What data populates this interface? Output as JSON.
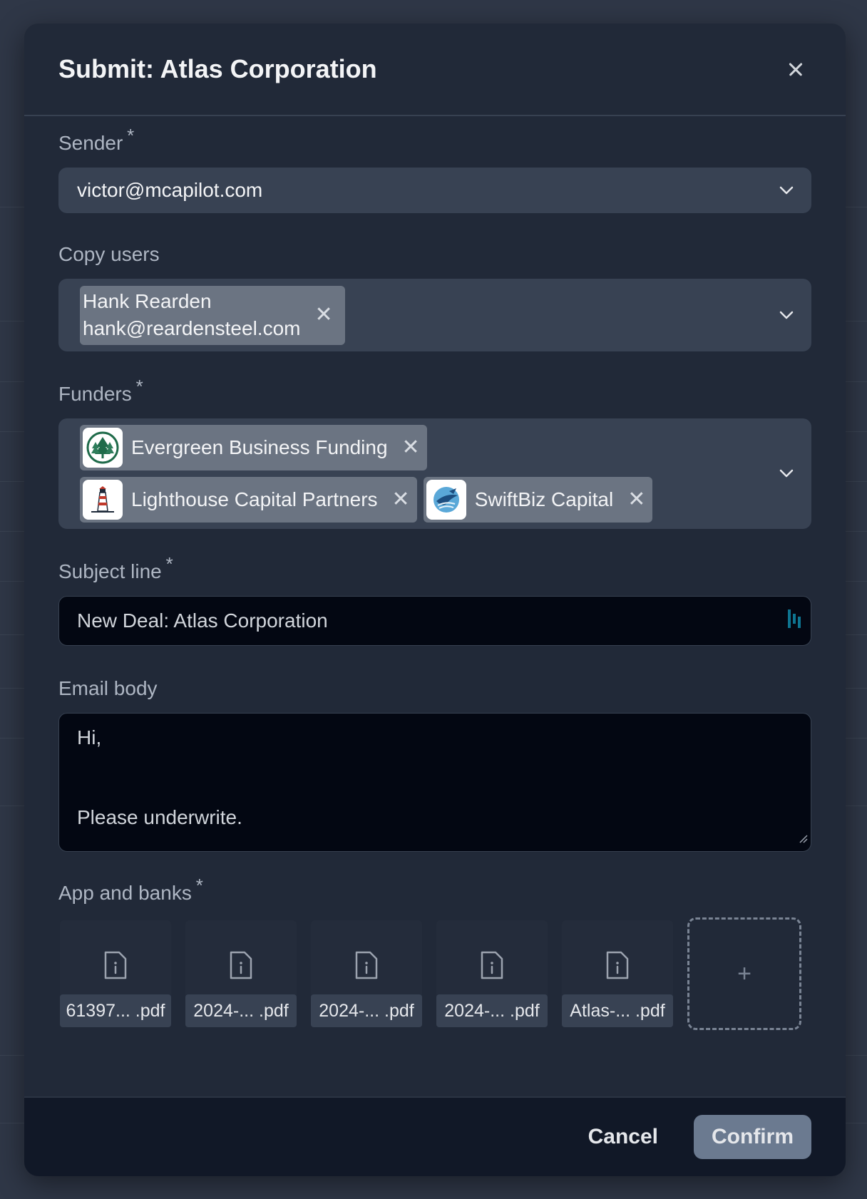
{
  "modal": {
    "title": "Submit: Atlas Corporation"
  },
  "sender": {
    "label": "Sender",
    "required": "*",
    "value": "victor@mcapilot.com"
  },
  "copy_users": {
    "label": "Copy users",
    "chips": [
      {
        "name": "Hank Rearden",
        "email": "hank@reardensteel.com"
      }
    ]
  },
  "funders": {
    "label": "Funders",
    "required": "*",
    "chips": [
      {
        "name": "Evergreen Business Funding",
        "logo": "pine-tree-icon"
      },
      {
        "name": "Lighthouse Capital Partners",
        "logo": "lighthouse-icon"
      },
      {
        "name": "SwiftBiz Capital",
        "logo": "bird-swirl-icon"
      }
    ]
  },
  "subject": {
    "label": "Subject line",
    "required": "*",
    "value": "New Deal: Atlas Corporation"
  },
  "email_body": {
    "label": "Email body",
    "line1": "Hi,",
    "line2": "Please underwrite."
  },
  "attachments": {
    "label": "App and banks",
    "required": "*",
    "files": [
      {
        "name": "61397... .pdf"
      },
      {
        "name": "2024-... .pdf"
      },
      {
        "name": "2024-... .pdf"
      },
      {
        "name": "2024-... .pdf"
      },
      {
        "name": "Atlas-... .pdf"
      }
    ],
    "add_label": "+"
  },
  "footer": {
    "cancel_label": "Cancel",
    "confirm_label": "Confirm"
  },
  "colors": {
    "modal_bg": "#212938",
    "select_bg": "#384253",
    "chip_bg": "#6b7482",
    "confirm_bg": "#6b7a90",
    "input_bg": "#030712"
  }
}
